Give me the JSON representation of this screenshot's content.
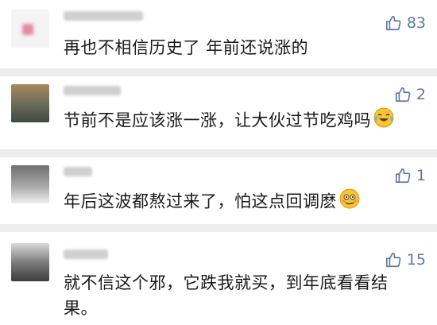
{
  "comments": [
    {
      "text": "再也不相信历史了 年前还说涨的",
      "likes": "83",
      "emoji": ""
    },
    {
      "text": "节前不是应该涨一涨，让大伙过节吃鸡吗",
      "likes": "2",
      "emoji": "crying-laughing-emoji"
    },
    {
      "text": "年后这波都熬过来了，怕这点回调麽",
      "likes": "1",
      "emoji": "nervous-smile-emoji"
    },
    {
      "text": "就不信这个邪，它跌我就买，到年底看看结果。",
      "likes": "15",
      "emoji": ""
    }
  ],
  "colors": {
    "background": "#ededed",
    "card": "#ffffff",
    "like": "#5a7aa0",
    "text": "#1a1a1a"
  }
}
